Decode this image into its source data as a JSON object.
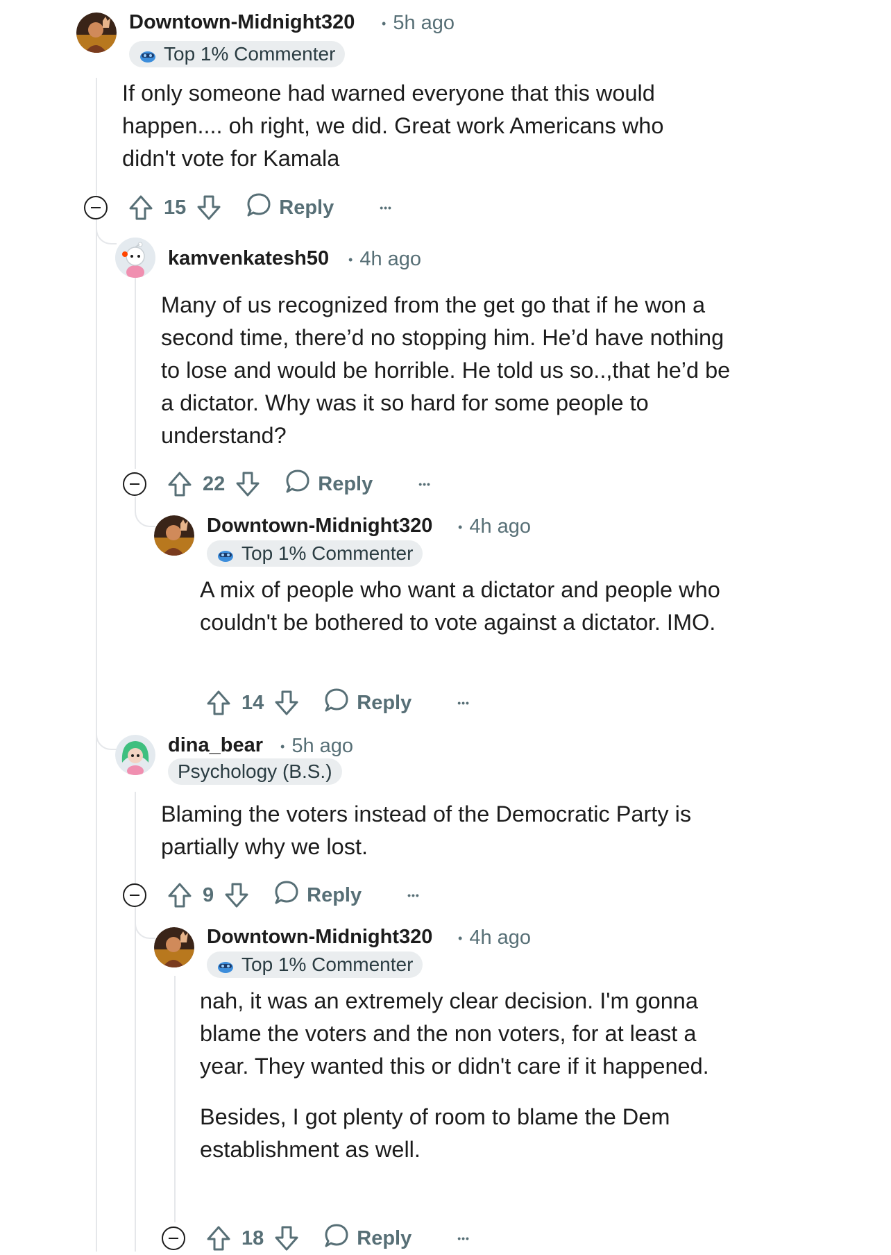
{
  "comments": [
    {
      "username": "Downtown-Midnight320",
      "time": "5h ago",
      "flair": "Top 1% Commenter",
      "body": [
        "If only someone had warned everyone that this would happen.... oh right, we did. Great work Americans who didn't vote for Kamala"
      ],
      "votes": "15",
      "reply_label": "Reply"
    },
    {
      "username": "kamvenkatesh50",
      "time": "4h ago",
      "flair": "",
      "body": [
        "Many of us recognized from the get go that if he won a second time, there’d no stopping him. He’d have nothing to lose and would be horrible. He told us so..,that he’d be a dictator. Why was it so hard for some people to understand?"
      ],
      "votes": "22",
      "reply_label": "Reply"
    },
    {
      "username": "Downtown-Midnight320",
      "time": "4h ago",
      "flair": "Top 1% Commenter",
      "body": [
        "A mix of people who want a dictator and people who couldn't be bothered to vote against a dictator. IMO."
      ],
      "votes": "14",
      "reply_label": "Reply"
    },
    {
      "username": "dina_bear",
      "time": "5h ago",
      "flair": "Psychology (B.S.)",
      "body": [
        "Blaming the voters instead of the Democratic Party is partially why we lost."
      ],
      "votes": "9",
      "reply_label": "Reply"
    },
    {
      "username": "Downtown-Midnight320",
      "time": "4h ago",
      "flair": "Top 1% Commenter",
      "body": [
        "nah, it was an extremely clear decision. I'm gonna blame the voters and the non voters, for at least a year. They wanted this or didn't care if it happened.",
        "Besides, I got plenty of room to blame the Dem establishment as well."
      ],
      "votes": "18",
      "reply_label": "Reply"
    }
  ],
  "meta_separator": "•",
  "more_glyph": "•••",
  "icons": {
    "upvote": "upvote-icon",
    "downvote": "downvote-icon",
    "reply": "reply-bubble-icon",
    "more": "more-options-icon",
    "collapse": "collapse-thread-icon"
  }
}
